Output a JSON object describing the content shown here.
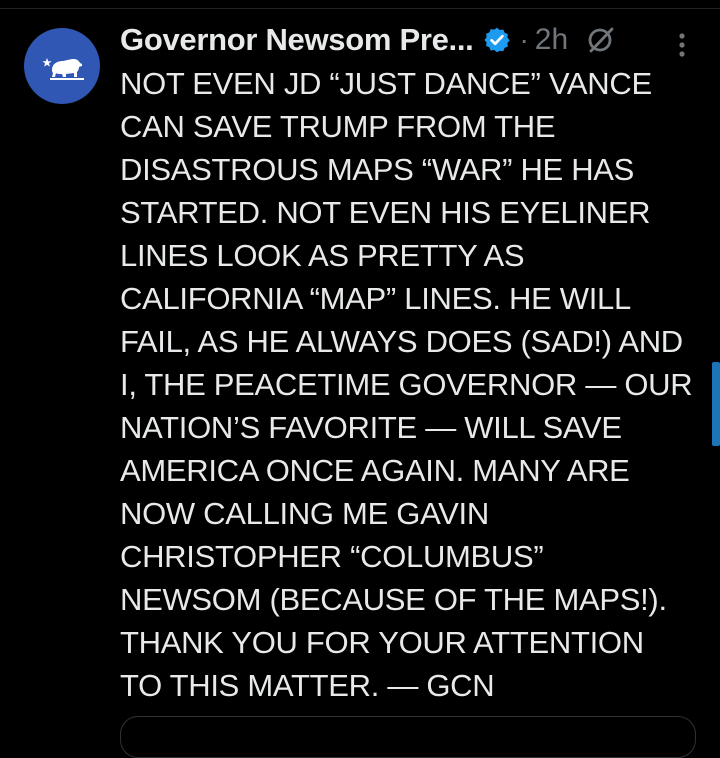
{
  "post": {
    "author": {
      "display_name": "Governor Newsom Pre...",
      "verified": true,
      "avatar_icon": "california-bear-flag-icon",
      "avatar_color": "#2f57b3"
    },
    "separator": "·",
    "timestamp": "2h",
    "grok_icon": "grok-slash-circle-icon",
    "more_icon": "vertical-ellipsis-icon",
    "body_lines": [
      "NOT EVEN JD “JUST DANCE” VANCE",
      "CAN SAVE TRUMP FROM THE",
      "DISASTROUS MAPS “WAR” HE HAS",
      "STARTED. NOT EVEN HIS EYELINER",
      "LINES LOOK AS PRETTY AS",
      "CALIFORNIA “MAP” LINES. HE WILL",
      "FAIL, AS HE ALWAYS DOES (SAD!) AND",
      "I, THE PEACETIME GOVERNOR — OUR",
      "NATION’S FAVORITE — WILL SAVE",
      "AMERICA ONCE AGAIN. MANY ARE",
      "NOW CALLING ME GAVIN",
      "CHRISTOPHER “COLUMBUS”",
      "NEWSOM (BECAUSE OF THE MAPS!).",
      "THANK YOU FOR YOUR ATTENTION",
      "TO THIS MATTER. — GCN"
    ]
  },
  "theme": {
    "background": "#000000",
    "text": "#e7e9ea",
    "muted": "#71767b",
    "verified_badge": "#1d9bf0",
    "scrollbar": "#1d75b8"
  }
}
